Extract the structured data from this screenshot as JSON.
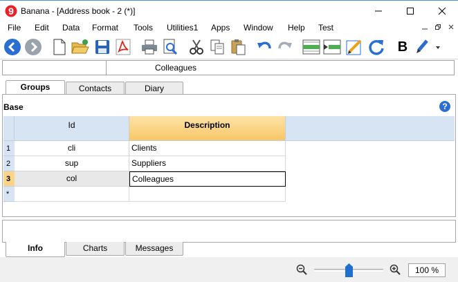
{
  "window": {
    "title": "Banana - [Address book - 2 (*)]",
    "app_icon_glyph": "9"
  },
  "menu": {
    "items": [
      "File",
      "Edit",
      "Data",
      "Format",
      "Tools",
      "Utilities1",
      "Apps",
      "Window",
      "Help",
      "Test"
    ]
  },
  "toolbar": {
    "icons": [
      "back-icon",
      "forward-icon",
      "new-file-icon",
      "open-folder-icon",
      "save-icon",
      "pdf-icon",
      "print-icon",
      "print-preview-icon",
      "cut-icon",
      "copy-icon",
      "paste-icon",
      "undo-icon",
      "redo-icon",
      "add-row-icon",
      "insert-row-icon",
      "edit-icon",
      "refresh-icon",
      "bold-icon",
      "highlight-pen-icon"
    ],
    "bold_label": "B"
  },
  "cellbar": {
    "address": "",
    "content": "Colleagues"
  },
  "table_tabs": [
    "Groups",
    "Contacts",
    "Diary"
  ],
  "section": {
    "title": "Base",
    "help_glyph": "?"
  },
  "table": {
    "columns": [
      "Id",
      "Description"
    ],
    "rows": [
      {
        "num": "1",
        "id": "cli",
        "description": "Clients"
      },
      {
        "num": "2",
        "id": "sup",
        "description": "Suppliers"
      },
      {
        "num": "3",
        "id": "col",
        "description": "Colleagues"
      },
      {
        "num": "*",
        "id": "",
        "description": ""
      }
    ],
    "selected_row": 3
  },
  "bottom_tabs": [
    "Info",
    "Charts",
    "Messages"
  ],
  "status": {
    "zoom": "100 %",
    "zoom_level": 1.0
  },
  "colors": {
    "accent_blue": "#2a6fd0",
    "header_blue": "#d7e4f3",
    "selected_header": "#fdd98f",
    "pdf_red": "#d9261c"
  }
}
